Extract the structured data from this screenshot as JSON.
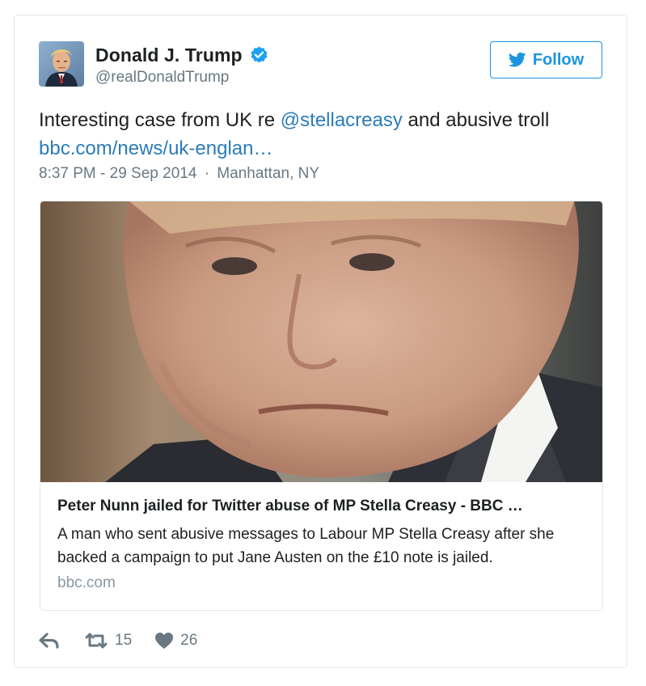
{
  "user": {
    "display_name": "Donald J. Trump",
    "handle": "@realDonaldTrump",
    "verified": true,
    "verified_icon": "verified-badge-icon"
  },
  "follow_button": {
    "label": "Follow",
    "icon": "twitter-bird-icon"
  },
  "tweet": {
    "text_before_mention": "Interesting case from UK re ",
    "mention": "@stellacreasy",
    "text_after_mention": " and abusive troll",
    "link": "bbc.com/news/uk-englan…",
    "time": "8:37 PM - 29 Sep 2014",
    "separator": "·",
    "location": "Manhattan, NY"
  },
  "link_card": {
    "title": "Peter Nunn jailed for Twitter abuse of MP Stella Creasy - BBC …",
    "description": "A man who sent abusive messages to Labour MP Stella Creasy after she backed a campaign to put Jane Austen on the £10 note is jailed.",
    "domain": "bbc.com",
    "image": "man-portrait-photo"
  },
  "actions": {
    "reply_icon": "reply-icon",
    "retweet_icon": "retweet-icon",
    "retweet_count": "15",
    "like_icon": "heart-icon",
    "like_count": "26"
  },
  "colors": {
    "link_blue": "#2b7bb9",
    "follow_blue": "#1b95e0",
    "secondary_text": "#697882",
    "border": "#e1e8ed"
  }
}
